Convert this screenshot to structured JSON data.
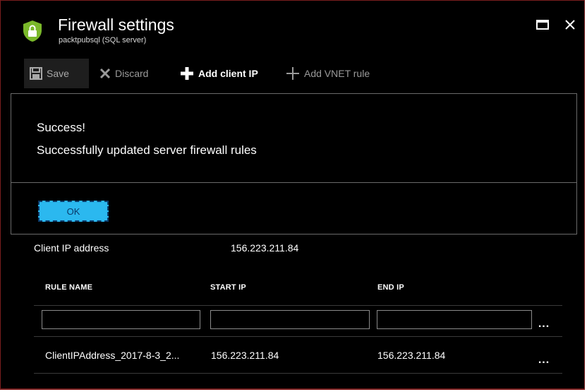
{
  "header": {
    "title": "Firewall settings",
    "subtitle": "packtpubsql (SQL server)",
    "shield_color": "#7ab82a",
    "icons": [
      "shield-lock-icon",
      "maximize-icon",
      "close-icon"
    ]
  },
  "toolbar": {
    "save_label": "Save",
    "discard_label": "Discard",
    "add_client_ip_label": "Add client IP",
    "add_vnet_rule_label": "Add VNET rule",
    "icons": [
      "save-icon",
      "discard-icon",
      "plus-icon",
      "plus-icon"
    ]
  },
  "notification": {
    "title": "Success!",
    "message": "Successfully updated server firewall rules",
    "ok_label": "OK",
    "ok_color": "#2bb8ef"
  },
  "client_ip": {
    "label": "Client IP address",
    "value": "156.223.211.84"
  },
  "rules_table": {
    "columns": [
      "RULE NAME",
      "START IP",
      "END IP"
    ],
    "new_rule": {
      "name": "",
      "start_ip": "",
      "end_ip": ""
    },
    "more_label": "...",
    "rows": [
      {
        "name": "ClientIPAddress_2017-8-3_2...",
        "start_ip": "156.223.211.84",
        "end_ip": "156.223.211.84"
      }
    ]
  }
}
